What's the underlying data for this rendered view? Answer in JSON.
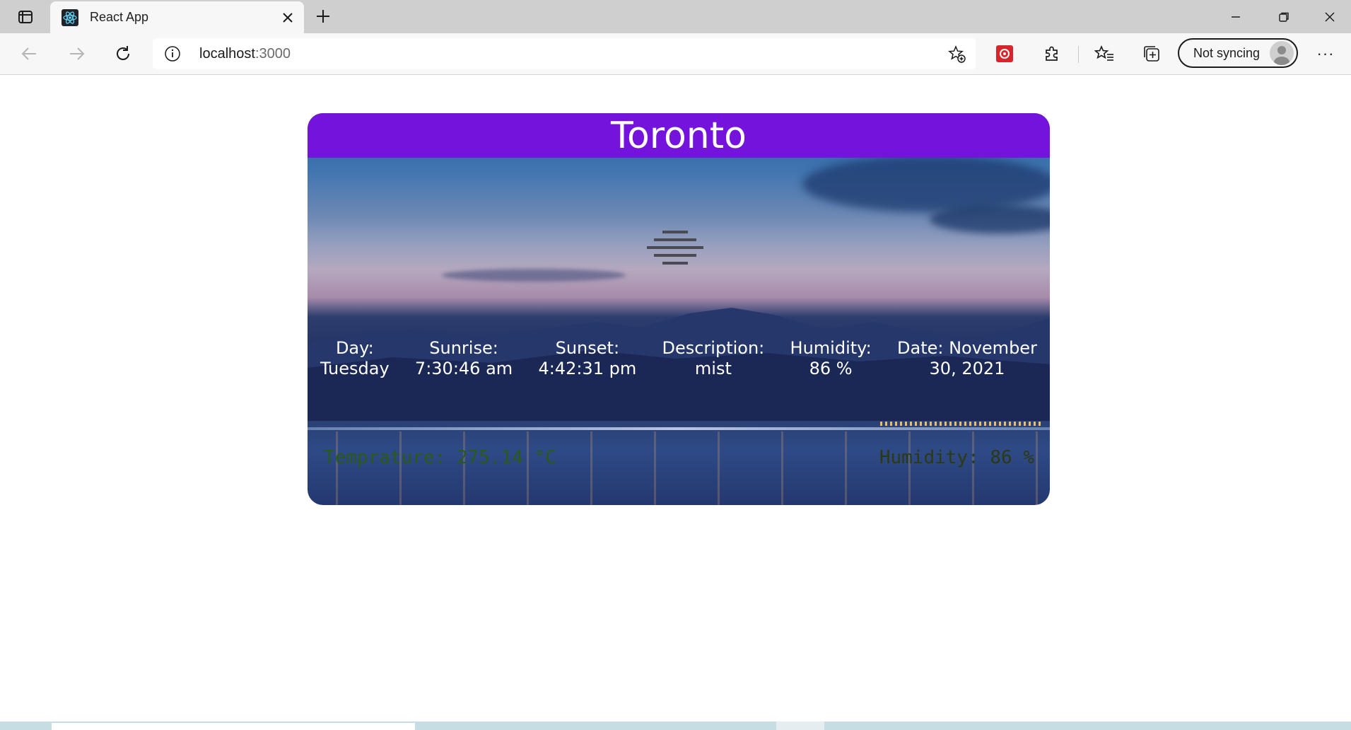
{
  "browser": {
    "tab_title": "React App",
    "url_host": "localhost",
    "url_port": ":3000",
    "sync_label": "Not syncing",
    "more_label": "···"
  },
  "weather": {
    "city": "Toronto",
    "icon": "mist-icon",
    "details": [
      {
        "label": "Day:",
        "value": "Tuesday"
      },
      {
        "label": "Sunrise:",
        "value": "7:30:46 am"
      },
      {
        "label": "Sunset:",
        "value": "4:42:31 pm"
      },
      {
        "label": "Description:",
        "value": "mist"
      },
      {
        "label": "Humidity:",
        "value": "86 %"
      },
      {
        "label": "Date: November",
        "value": "30, 2021"
      }
    ],
    "temperature_text": "Temprature: 275.14 °C",
    "humidity_text": "Humidity: 86 %"
  },
  "colors": {
    "header": "#7413dc",
    "temperature_text": "#2a5a18",
    "humidity_text": "#2c3a14"
  }
}
